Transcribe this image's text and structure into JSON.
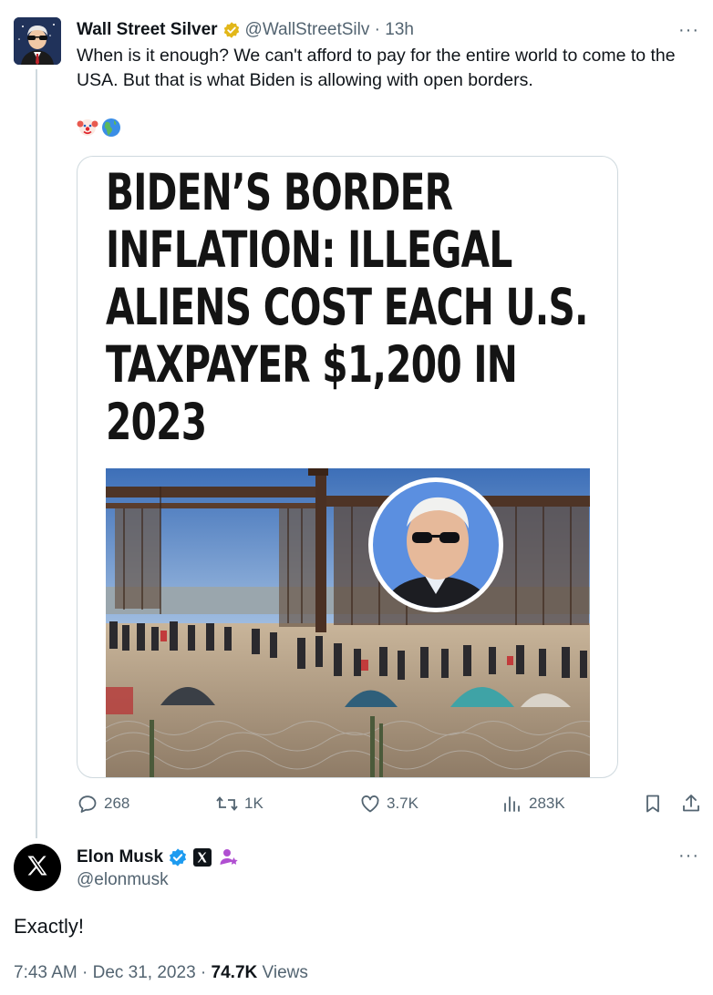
{
  "tweet1": {
    "author_name": "Wall Street Silver",
    "handle": "@WallStreetSilv",
    "time": "13h",
    "separator": "·",
    "text": "When is it enough? We can't afford to pay for the entire world to come to the USA. But that is what Biden is allowing with open borders.",
    "emoji": [
      "🤡",
      "🌎"
    ],
    "more": "···",
    "card": {
      "headline_lines": [
        "BIDEN’S BORDER",
        "INFLATION: ILLEGAL",
        "ALIENS COST EACH U.S.",
        "TAXPAYER $1,200 IN",
        "2023"
      ]
    },
    "actions": {
      "replies": "268",
      "reposts": "1K",
      "likes": "3.7K",
      "views": "283K"
    }
  },
  "tweet2": {
    "author_name": "Elon Musk",
    "handle": "@elonmusk",
    "text": "Exactly!",
    "more": "···",
    "time": "7:43 AM",
    "date": "Dec 31, 2023",
    "separator": "·",
    "views_count": "74.7K",
    "views_label": "Views"
  },
  "colors": {
    "gold_badge": "#e2b719",
    "blue_badge": "#1d9bf0",
    "muted_text": "#536471",
    "thread_line": "#cfd9de"
  }
}
